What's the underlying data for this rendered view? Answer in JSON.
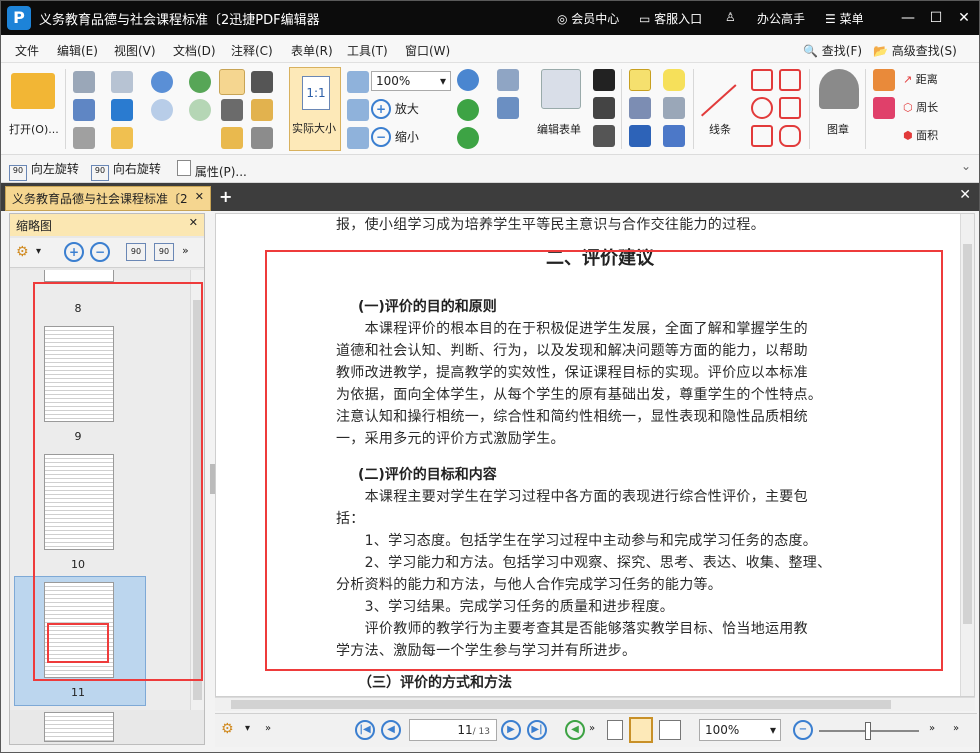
{
  "window": {
    "title": "义务教育品德与社会课程标准〔2迅捷PDF编辑器",
    "member_center": "会员中心",
    "customer_service": "客服入口",
    "office_master": "办公高手",
    "menu": "菜单"
  },
  "menubar": {
    "items": [
      "文件",
      "编辑(E)",
      "视图(V)",
      "文档(D)",
      "注释(C)",
      "表单(R)",
      "工具(T)",
      "窗口(W)"
    ],
    "find": "查找(F)",
    "advanced_find": "高级查找(S)"
  },
  "ribbon": {
    "open": "打开(O)...",
    "actual_size": "实际大小",
    "zoom_value": "100%",
    "zoom_in": "放大",
    "zoom_out": "缩小",
    "edit_form": "编辑表单",
    "line": "线条",
    "stamp": "图章",
    "distance": "距离",
    "perimeter": "周长",
    "area": "面积"
  },
  "subbar": {
    "rotate_left": "向左旋转",
    "rotate_right": "向右旋转",
    "properties": "属性(P)..."
  },
  "tab": {
    "doc_title": "义务教育品德与社会课程标准〔2"
  },
  "sidebar": {
    "title": "缩略图",
    "pages": [
      "8",
      "9",
      "10",
      "11"
    ]
  },
  "document": {
    "top_line": "报，使小组学习成为培养学生平等民主意识与合作交往能力的过程。",
    "heading": "二、评价建议",
    "sec1_title": "(一)评价的目的和原则",
    "sec1_lines": [
      "　　本课程评价的根本目的在于积极促进学生发展，全面了解和掌握学生的",
      "道德和社会认知、判断、行为，以及发现和解决问题等方面的能力，以帮助",
      "教师改进教学，提高教学的实效性，保证课程目标的实现。评价应以本标准",
      "为依据，面向全体学生，从每个学生的原有基础出发，尊重学生的个性特点。",
      "注意认知和操行相统一，综合性和简约性相统一，显性表现和隐性品质相统",
      "一，采用多元的评价方式激励学生。"
    ],
    "sec2_title": "(二)评价的目标和内容",
    "sec2_lines": [
      "　　本课程主要对学生在学习过程中各方面的表现进行综合性评价，主要包",
      "括：",
      "　　1、学习态度。包括学生在学习过程中主动参与和完成学习任务的态度。",
      "　　2、学习能力和方法。包括学习中观察、探究、思考、表达、收集、整理、",
      "分析资料的能力和方法，与他人合作完成学习任务的能力等。",
      "　　3、学习结果。完成学习任务的质量和进步程度。",
      "　　评价教师的教学行为主要考查其是否能够落实教学目标、恰当地运用教",
      "学方法、激励每一个学生参与学习并有所进步。"
    ],
    "sec3_title": "（三）评价的方式和方法"
  },
  "statusbar": {
    "page_input": "11",
    "page_total": "/ 13",
    "zoom": "100%"
  },
  "colors": {
    "titlebar": "#0c0c0c",
    "highlight_box": "#ee3b3b",
    "tab_active": "#f5d690",
    "accent_blue": "#3b7fd0"
  }
}
